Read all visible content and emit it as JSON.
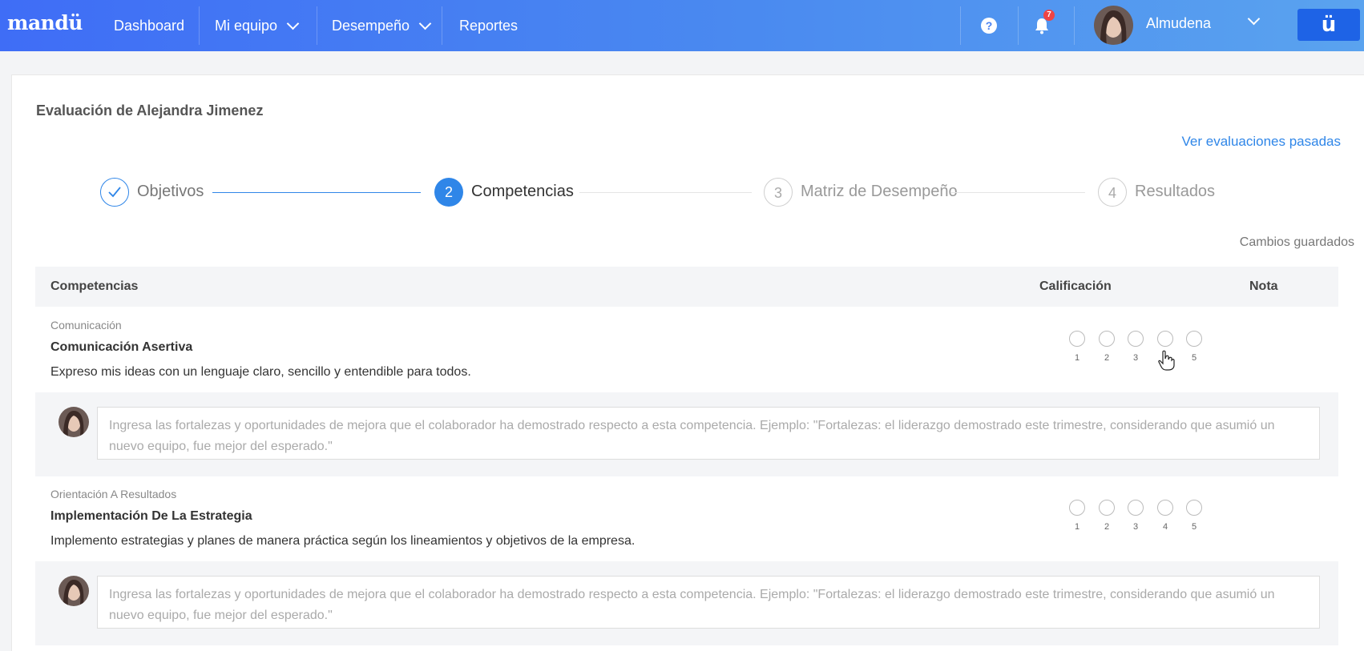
{
  "navbar": {
    "logo": "mandü",
    "items": [
      "Dashboard",
      "Mi equipo",
      "Desempeño",
      "Reportes"
    ],
    "help_label": "?",
    "notification_count": "7",
    "user_name": "Almudena",
    "brand_glyph": "ü"
  },
  "page": {
    "title": "Evaluación de Alejandra Jimenez",
    "past_link": "Ver evaluaciones pasadas",
    "saved_status": "Cambios guardados"
  },
  "stepper": {
    "steps": [
      {
        "number": "✓",
        "label": "Objetivos",
        "state": "done"
      },
      {
        "number": "2",
        "label": "Competencias",
        "state": "active"
      },
      {
        "number": "3",
        "label": "Matriz de Desempeño",
        "state": "pending"
      },
      {
        "number": "4",
        "label": "Resultados",
        "state": "pending"
      }
    ]
  },
  "table": {
    "headers": {
      "competencias": "Competencias",
      "calificacion": "Calificación",
      "nota": "Nota"
    },
    "rating_scale": [
      "1",
      "2",
      "3",
      "4",
      "5"
    ],
    "rows": [
      {
        "category": "Comunicación",
        "name": "Comunicación Asertiva",
        "description": "Expreso mis ideas con un lenguaje claro, sencillo y entendible para todos.",
        "selected_rating": null,
        "comment_placeholder": "Ingresa las fortalezas y oportunidades de mejora que el colaborador ha demostrado respecto a esta competencia. Ejemplo: \"Fortalezas: el liderazgo demostrado este trimestre, considerando que asumió un nuevo equipo, fue mejor del esperado.\""
      },
      {
        "category": "Orientación A Resultados",
        "name": "Implementación De La Estrategia",
        "description": "Implemento estrategias y planes de manera práctica según los lineamientos y objetivos de la empresa.",
        "selected_rating": null,
        "comment_placeholder": "Ingresa las fortalezas y oportunidades de mejora que el colaborador ha demostrado respecto a esta competencia. Ejemplo: \"Fortalezas: el liderazgo demostrado este trimestre, considerando que asumió un nuevo equipo, fue mejor del esperado.\""
      }
    ]
  },
  "colors": {
    "accent": "#2f86e8",
    "nav_gradient_start": "#3f6df6",
    "nav_gradient_end": "#5aa3ef",
    "brand_button": "#1e63e6",
    "badge": "#ef4444"
  }
}
